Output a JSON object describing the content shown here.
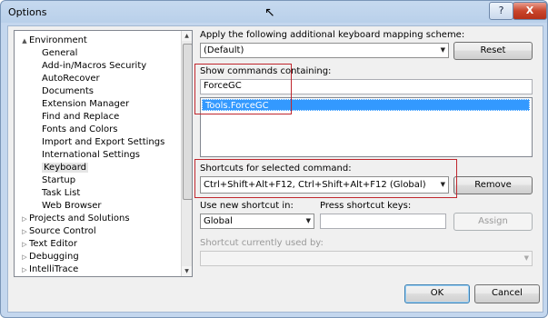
{
  "window": {
    "title": "Options",
    "help_label": "?",
    "close_label": "X"
  },
  "tree": {
    "items": [
      {
        "label": "Environment",
        "expander": "▲",
        "level": 0
      },
      {
        "label": "General",
        "level": 1
      },
      {
        "label": "Add-in/Macros Security",
        "level": 1
      },
      {
        "label": "AutoRecover",
        "level": 1
      },
      {
        "label": "Documents",
        "level": 1
      },
      {
        "label": "Extension Manager",
        "level": 1
      },
      {
        "label": "Find and Replace",
        "level": 1
      },
      {
        "label": "Fonts and Colors",
        "level": 1
      },
      {
        "label": "Import and Export Settings",
        "level": 1
      },
      {
        "label": "International Settings",
        "level": 1
      },
      {
        "label": "Keyboard",
        "level": 1,
        "selected": true
      },
      {
        "label": "Startup",
        "level": 1
      },
      {
        "label": "Task List",
        "level": 1
      },
      {
        "label": "Web Browser",
        "level": 1
      },
      {
        "label": "Projects and Solutions",
        "expander": "▷",
        "level": 0
      },
      {
        "label": "Source Control",
        "expander": "▷",
        "level": 0
      },
      {
        "label": "Text Editor",
        "expander": "▷",
        "level": 0
      },
      {
        "label": "Debugging",
        "expander": "▷",
        "level": 0
      },
      {
        "label": "IntelliTrace",
        "expander": "▷",
        "level": 0
      }
    ]
  },
  "mapping": {
    "label": "Apply the following additional keyboard mapping scheme:",
    "value": "(Default)",
    "reset_label": "Reset"
  },
  "commands": {
    "label": "Show commands containing:",
    "search_value": "ForceGC",
    "results": [
      "Tools.ForceGC"
    ]
  },
  "shortcuts": {
    "label": "Shortcuts for selected command:",
    "value": "Ctrl+Shift+Alt+F12, Ctrl+Shift+Alt+F12 (Global)",
    "remove_label": "Remove"
  },
  "new_shortcut": {
    "use_label": "Use new shortcut in:",
    "use_value": "Global",
    "press_label": "Press shortcut keys:",
    "press_value": "",
    "assign_label": "Assign"
  },
  "current_use": {
    "label": "Shortcut currently used by:",
    "value": ""
  },
  "footer": {
    "ok_label": "OK",
    "cancel_label": "Cancel"
  }
}
